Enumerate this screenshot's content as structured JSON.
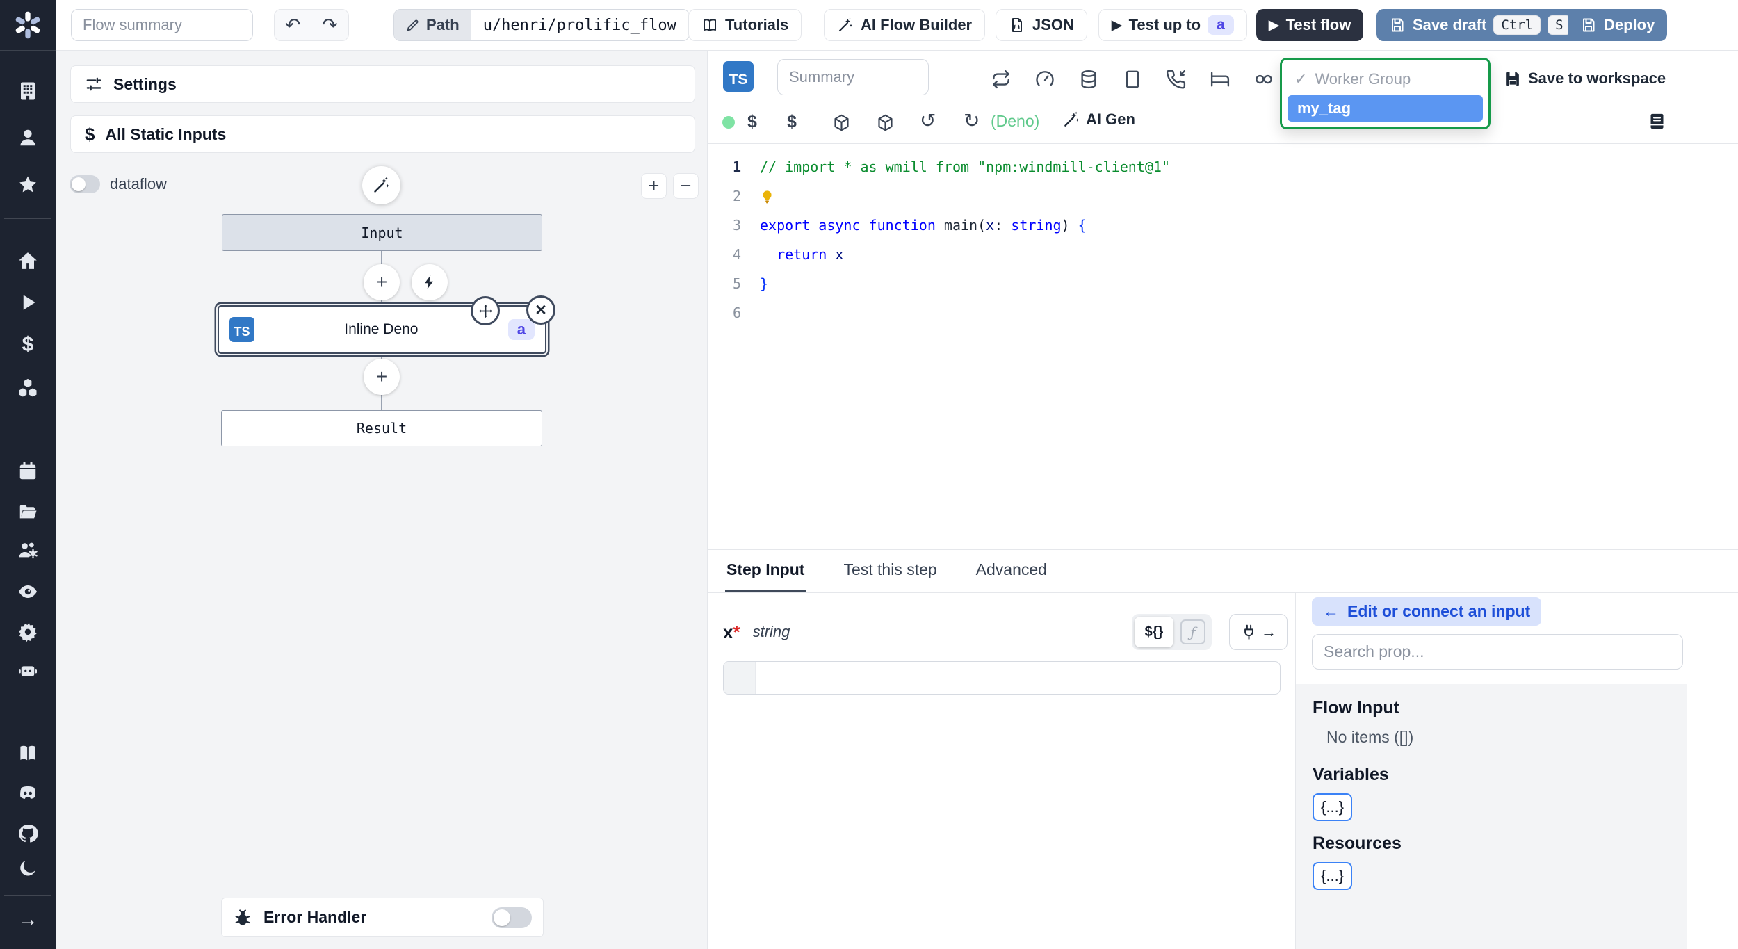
{
  "toolbar": {
    "flow_summary_placeholder": "Flow summary",
    "path_label": "Path",
    "path_value": "u/henri/prolific_flow",
    "tutorials": "Tutorials",
    "ai_flow_builder": "AI Flow Builder",
    "json": "JSON",
    "test_up_to": "Test up to",
    "test_up_to_badge": "a",
    "test_flow": "Test flow",
    "save_draft": "Save draft",
    "save_draft_kbd": [
      "Ctrl",
      "S"
    ],
    "deploy": "Deploy"
  },
  "flow": {
    "settings": "Settings",
    "all_static_inputs": "All Static Inputs",
    "dataflow": "dataflow",
    "zoom_in": "+",
    "zoom_out": "−",
    "nodes": {
      "input": "Input",
      "step_lang_badge": "TS",
      "step": "Inline Deno",
      "step_id_badge": "a",
      "result": "Result"
    },
    "error_handler": "Error Handler"
  },
  "editor": {
    "lang_badge": "TS",
    "summary_placeholder": "Summary",
    "language": "(Deno)",
    "ai_gen": "AI Gen",
    "save_to_workspace": "Save to workspace",
    "worker_group": {
      "check": "✓",
      "title": "Worker Group",
      "selected": "my_tag"
    },
    "code": {
      "lines": [
        [
          [
            "c",
            "// import * as wmill from \"npm:windmill-client@1\""
          ]
        ],
        [
          [
            "bulb",
            ""
          ]
        ],
        [
          [
            "k",
            "export "
          ],
          [
            "k",
            "async "
          ],
          [
            "k",
            "function "
          ],
          [
            "f",
            "main"
          ],
          [
            "pn",
            "("
          ],
          [
            "v",
            "x"
          ],
          [
            "pn",
            ": "
          ],
          [
            "k",
            "string"
          ],
          [
            "pn",
            ") "
          ],
          [
            "b",
            "{"
          ]
        ],
        [
          [
            "pn",
            "  "
          ],
          [
            "k",
            "return "
          ],
          [
            "v",
            "x"
          ]
        ],
        [
          [
            "b",
            "}"
          ]
        ],
        []
      ]
    }
  },
  "step_panel": {
    "tabs": [
      "Step Input",
      "Test this step",
      "Advanced"
    ],
    "field": {
      "name": "x",
      "required": "*",
      "type": "string"
    },
    "toggles": {
      "expr": "${}",
      "fn": "ƒ"
    }
  },
  "props_panel": {
    "back_arrow": "←",
    "edit_connect": "Edit or connect an input",
    "search_placeholder": "Search prop...",
    "flow_input": "Flow Input",
    "no_items": "No items ([])",
    "variables": "Variables",
    "resources": "Resources",
    "braces": "{...}"
  },
  "icons": {
    "sidebar": [
      "windmill-logo",
      "workspace",
      "user",
      "favorites",
      "home",
      "runs",
      "variables",
      "resources",
      "schedules",
      "folders",
      "groups",
      "audit-logs",
      "settings",
      "ai",
      "docs",
      "discord",
      "github",
      "dark-mode",
      "collapse-sidebar"
    ],
    "toolbar": [
      "undo",
      "redo",
      "pencil",
      "book",
      "magic-wand",
      "json-file",
      "play",
      "save"
    ],
    "editor_header": [
      "retries",
      "early-stop",
      "cache",
      "mock",
      "suspend",
      "sleep",
      "concurrency",
      "dollar",
      "package",
      "undo",
      "redo",
      "library"
    ],
    "misc": [
      "plus",
      "lightning-bolt",
      "move",
      "close",
      "bug",
      "plug",
      "function",
      "lightbulb"
    ]
  }
}
